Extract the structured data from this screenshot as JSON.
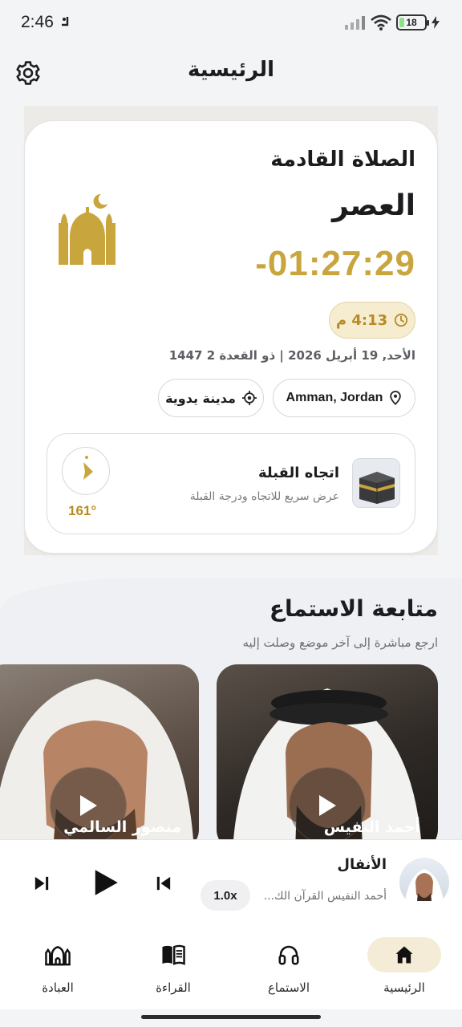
{
  "status_bar": {
    "time": "2:46",
    "battery": "18",
    "battery_level": 0.18
  },
  "header": {
    "title": "الرئيسية",
    "settings_icon": "gear-icon"
  },
  "next_prayer": {
    "label": "الصلاة القادمة",
    "name": "العصر",
    "countdown": "-01:27:29",
    "time": "4:13 م",
    "date": "الأحد, 19 أبريل 2026 | ذو القعدة 2 1447",
    "location": "Amman, Jordan",
    "manual_city": "مدينة يدوية"
  },
  "qibla": {
    "title": "اتجاه القبلة",
    "subtitle": "عرض سريع للاتجاه ودرجة القبلة",
    "degrees": "161°"
  },
  "continue_listening": {
    "title": "متابعة الاستماع",
    "subtitle": "ارجع مباشرة إلى آخر موضع وصلت إليه",
    "reciters": [
      {
        "name": "أحمد النفيس"
      },
      {
        "name": "منصور السالمي"
      }
    ]
  },
  "mini_player": {
    "surah": "الأنفال",
    "reciter": "أحمد النفيس القرآن الك...",
    "speed": "1.0x"
  },
  "bottom_nav": [
    {
      "label": "الرئيسية",
      "icon": "home-icon",
      "active": true
    },
    {
      "label": "الاستماع",
      "icon": "headphones-icon",
      "active": false
    },
    {
      "label": "القراءة",
      "icon": "book-icon",
      "active": false
    },
    {
      "label": "العبادة",
      "icon": "mosque-icon",
      "active": false
    }
  ],
  "colors": {
    "accent": "#c9a53e",
    "active_nav_bg": "#f5ecd7"
  }
}
